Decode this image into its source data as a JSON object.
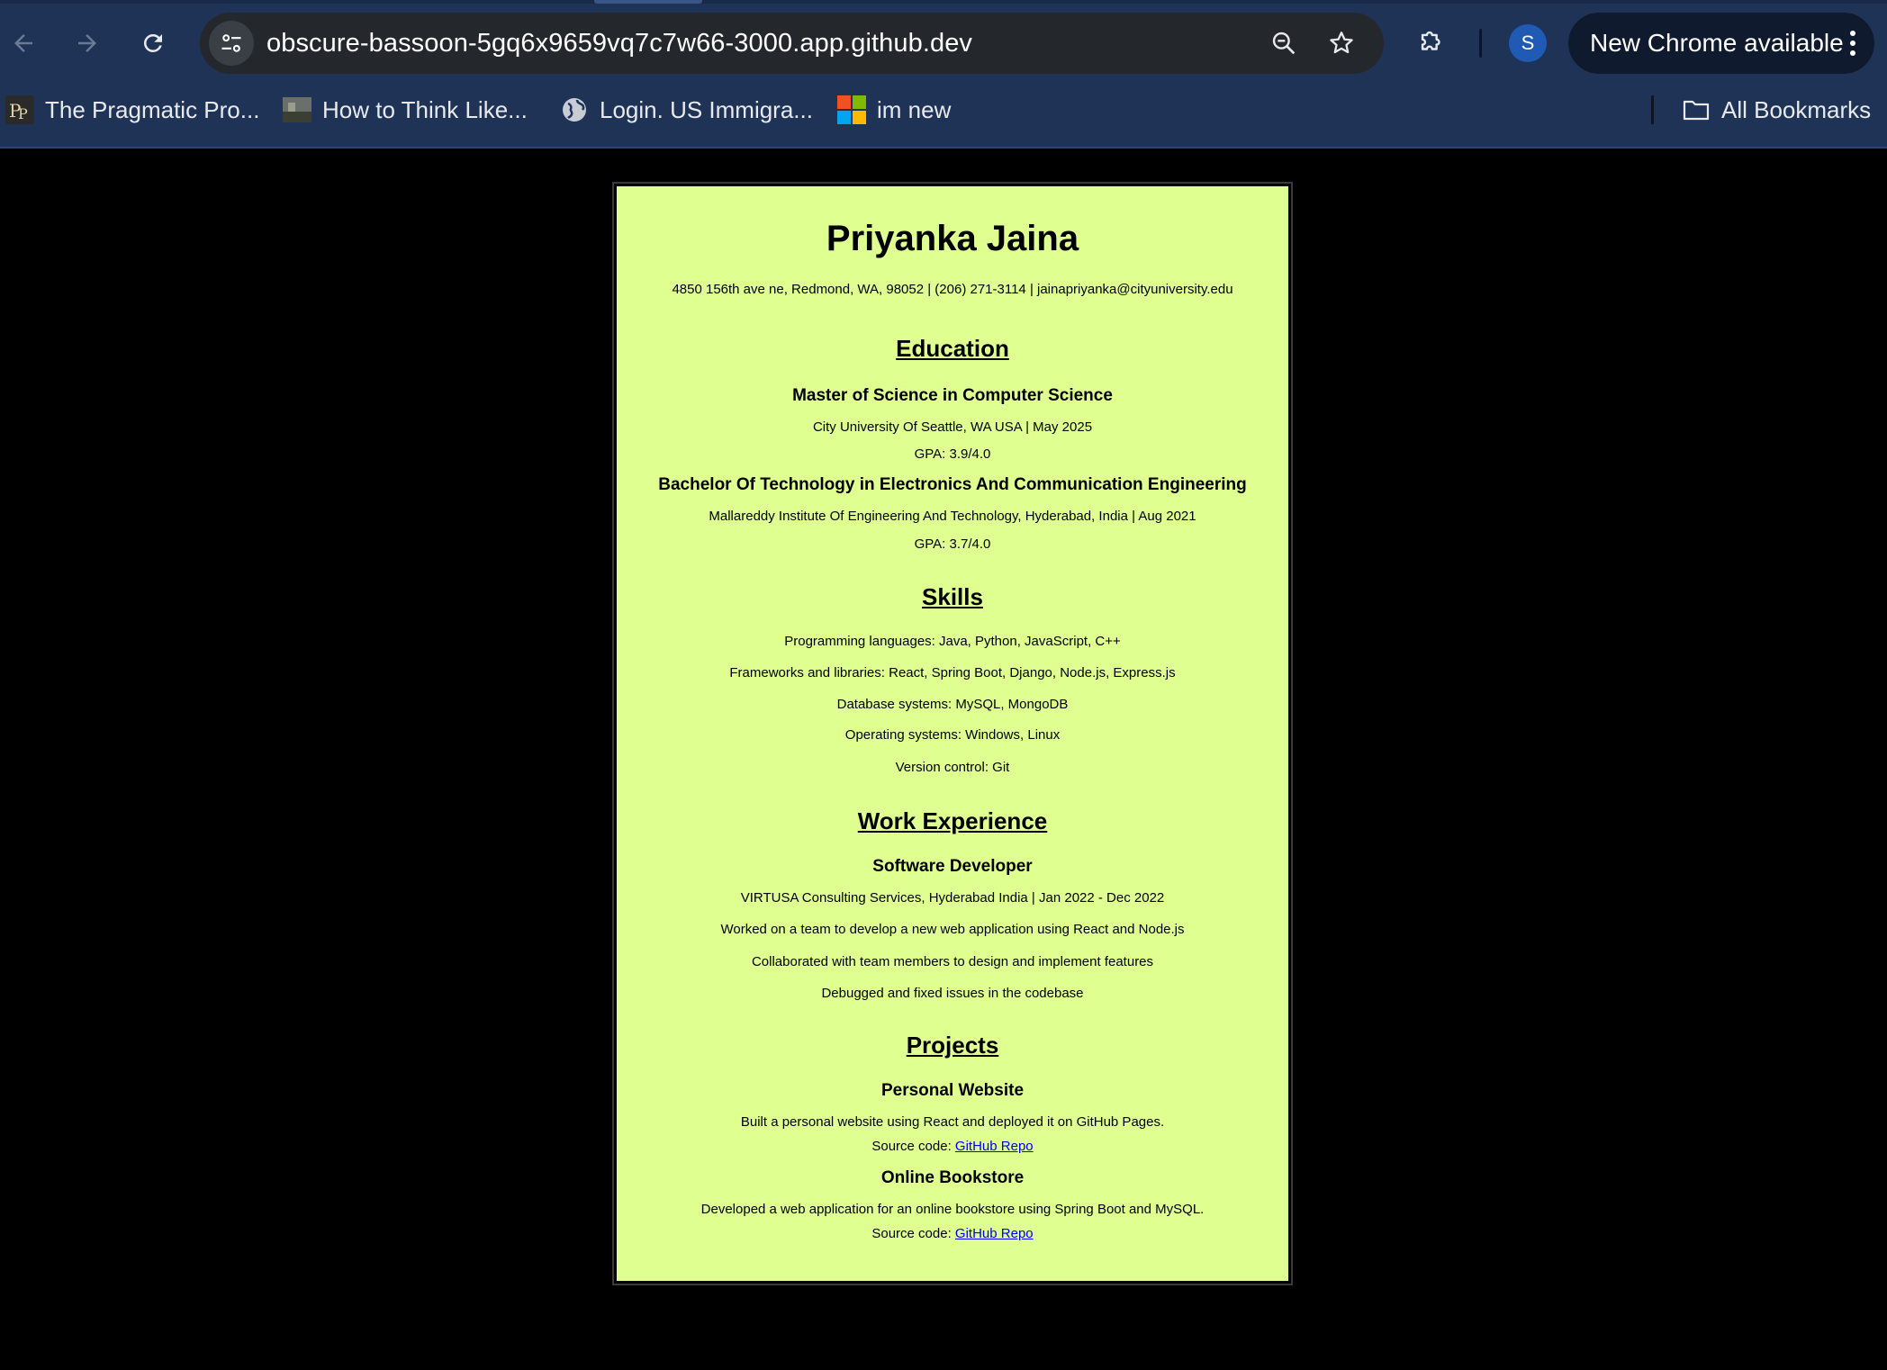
{
  "browser": {
    "url": "obscure-bassoon-5gq6x9659vq7c7w66-3000.app.github.dev",
    "profile_initial": "S",
    "update_label": "New Chrome available",
    "bookmarks": [
      {
        "label": "The Pragmatic Pro...",
        "icon": "pragmatic-programmer-favicon"
      },
      {
        "label": "How to Think Like...",
        "icon": "book-thumbnail-favicon"
      },
      {
        "label": "Login. US Immigra...",
        "icon": "globe-icon"
      },
      {
        "label": "im new",
        "icon": "microsoft-logo-icon"
      }
    ],
    "all_bookmarks_label": "All Bookmarks",
    "colors": {
      "frame": "#1f3357",
      "omnibox": "#24272c",
      "avatar": "#1f5bb5"
    }
  },
  "resume": {
    "background": "#dfff91",
    "name": "Priyanka Jaina",
    "contact": "4850 156th ave ne, Redmond, WA, 98052 | (206) 271-3114 | jainapriyanka@cityuniversity.edu",
    "education": {
      "title": "Education",
      "entries": [
        {
          "degree": "Master of Science in Computer Science",
          "school": "City University Of Seattle, WA USA | May 2025",
          "gpa": "GPA: 3.9/4.0"
        },
        {
          "degree": "Bachelor Of Technology in Electronics And Communication Engineering",
          "school": "Mallareddy Institute Of Engineering And Technology, Hyderabad, India | Aug 2021",
          "gpa": "GPA: 3.7/4.0"
        }
      ]
    },
    "skills": {
      "title": "Skills",
      "items": [
        "Programming languages: Java, Python, JavaScript, C++",
        "Frameworks and libraries: React, Spring Boot, Django, Node.js, Express.js",
        "Database systems: MySQL, MongoDB",
        "Operating systems: Windows, Linux",
        "Version control: Git"
      ]
    },
    "work": {
      "title": "Work Experience",
      "role": "Software Developer",
      "company": "VIRTUSA Consulting Services, Hyderabad India | Jan 2022 - Dec 2022",
      "duties": [
        "Worked on a team to develop a new web application using React and Node.js",
        "Collaborated with team members to design and implement features",
        "Debugged and fixed issues in the codebase"
      ]
    },
    "projects": {
      "title": "Projects",
      "entries": [
        {
          "name": "Personal Website",
          "description": "Built a personal website using React and deployed it on GitHub Pages.",
          "source_prefix": "Source code: ",
          "link_text": "GitHub Repo"
        },
        {
          "name": "Online Bookstore",
          "description": "Developed a web application for an online bookstore using Spring Boot and MySQL.",
          "source_prefix": "Source code: ",
          "link_text": "GitHub Repo"
        }
      ]
    }
  }
}
